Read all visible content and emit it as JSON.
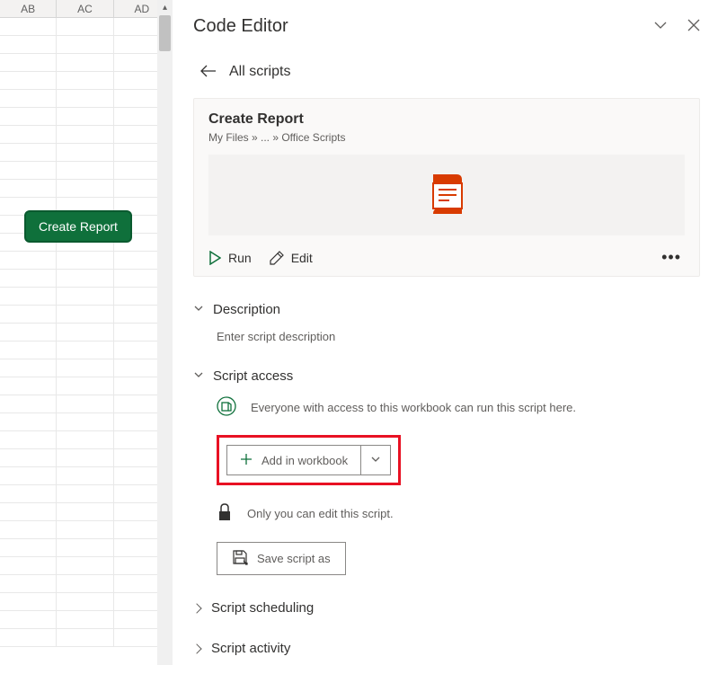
{
  "grid": {
    "columns": [
      "AB",
      "AC",
      "AD"
    ],
    "button_label": "Create Report"
  },
  "panel": {
    "title": "Code Editor",
    "back_label": "All scripts",
    "script": {
      "name": "Create Report",
      "breadcrumb": "My Files » ... » Office Scripts"
    },
    "actions": {
      "run": "Run",
      "edit": "Edit"
    },
    "sections": {
      "description": {
        "title": "Description",
        "placeholder": "Enter script description"
      },
      "access": {
        "title": "Script access",
        "everyone_text": "Everyone with access to this workbook can run this script here.",
        "add_button": "Add in workbook",
        "only_you": "Only you can edit this script.",
        "save_as": "Save script as"
      },
      "scheduling": {
        "title": "Script scheduling"
      },
      "activity": {
        "title": "Script activity"
      }
    }
  }
}
